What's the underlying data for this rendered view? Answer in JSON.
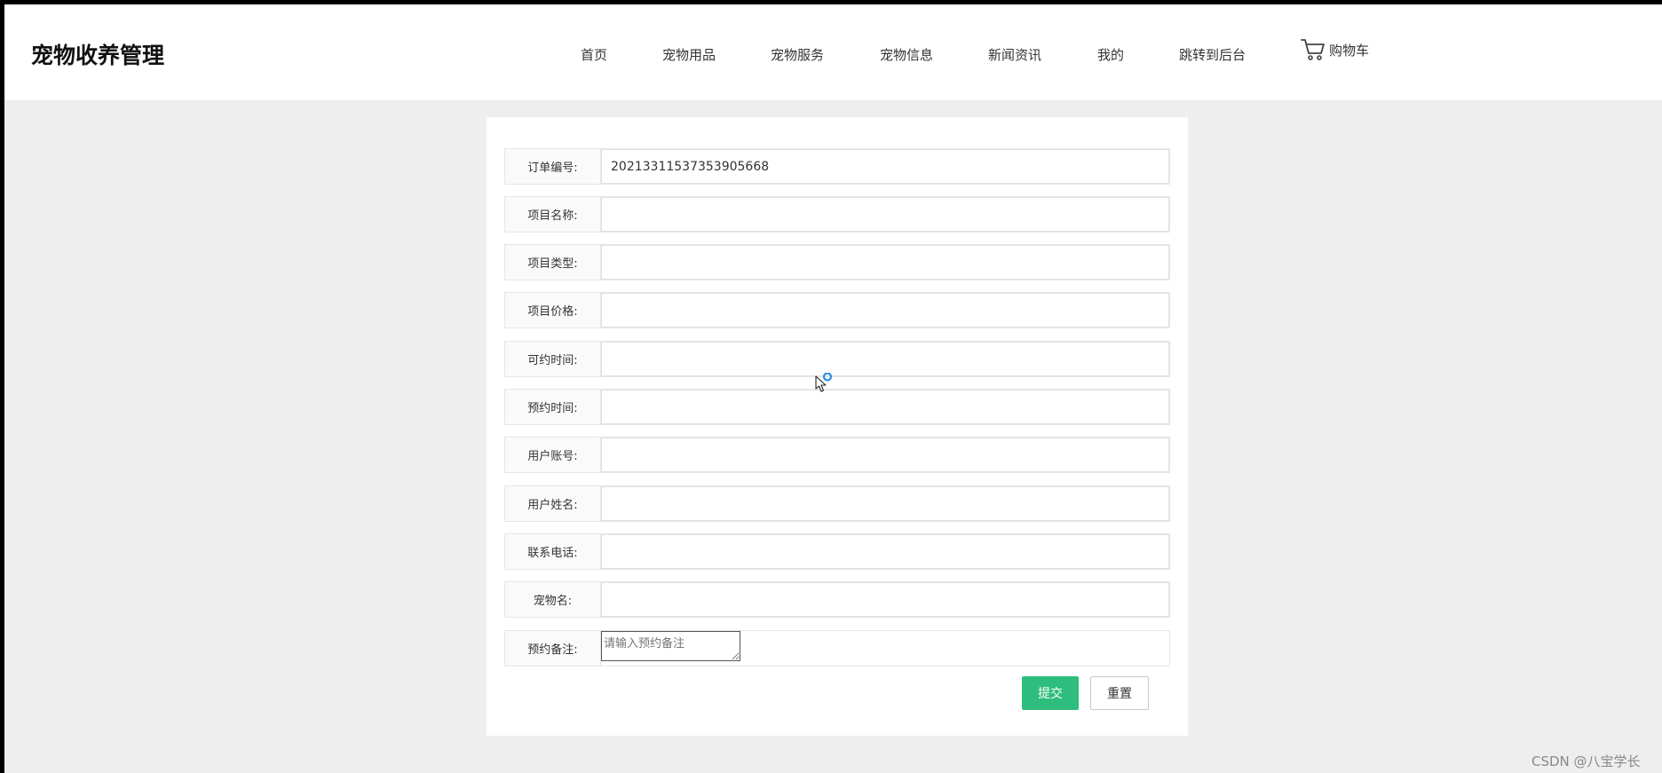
{
  "header": {
    "logo": "宠物收养管理",
    "nav": [
      {
        "label": "首页"
      },
      {
        "label": "宠物用品"
      },
      {
        "label": "宠物服务"
      },
      {
        "label": "宠物信息"
      },
      {
        "label": "新闻资讯"
      },
      {
        "label": "我的"
      },
      {
        "label": "跳转到后台"
      }
    ],
    "cart": {
      "label": "购物车",
      "icon": "cart-icon"
    }
  },
  "form": {
    "fields": [
      {
        "label": "订单编号:",
        "value": "20213311537353905668"
      },
      {
        "label": "项目名称:",
        "value": ""
      },
      {
        "label": "项目类型:",
        "value": ""
      },
      {
        "label": "项目价格:",
        "value": ""
      },
      {
        "label": "可约时间:",
        "value": ""
      },
      {
        "label": "预约时间:",
        "value": ""
      },
      {
        "label": "用户账号:",
        "value": ""
      },
      {
        "label": "用户姓名:",
        "value": ""
      },
      {
        "label": "联系电话:",
        "value": ""
      },
      {
        "label": "宠物名:",
        "value": ""
      }
    ],
    "remark": {
      "label": "预约备注:",
      "placeholder": "请输入预约备注"
    },
    "submit_label": "提交",
    "reset_label": "重置"
  },
  "watermark": "CSDN @八宝学长",
  "colors": {
    "accent": "#2ebd7c",
    "page_bg": "#eeeeee"
  }
}
